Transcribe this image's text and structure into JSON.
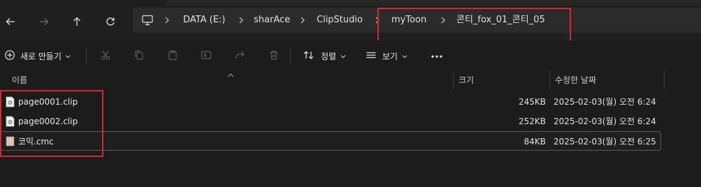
{
  "colors": {
    "accent_red": "#d8262b",
    "background": "#1c1c1c",
    "address_bg": "#2b2b2b"
  },
  "nav": {
    "back_icon": "arrow-left-icon",
    "forward_icon": "arrow-right-icon",
    "up_icon": "arrow-up-icon",
    "refresh_icon": "refresh-icon"
  },
  "address": {
    "root_icon": "this-pc-icon",
    "crumbs": [
      "DATA (E:)",
      "sharAce",
      "ClipStudio",
      "myToon",
      "콘티_fox_01_콘티_05"
    ]
  },
  "toolbar": {
    "new_label": "새로 만들기",
    "sort_label": "정렬",
    "view_label": "보기",
    "more_icon": "more-icon"
  },
  "columns": {
    "name": "이름",
    "size": "크기",
    "modified": "수정한 날짜"
  },
  "files": [
    {
      "name": "page0001.clip",
      "size": "245KB",
      "modified": "2025-02-03(월) 오전 6:24",
      "icon": "clip-file-icon"
    },
    {
      "name": "page0002.clip",
      "size": "252KB",
      "modified": "2025-02-03(월) 오전 6:24",
      "icon": "clip-file-icon"
    },
    {
      "name": "코믹.cmc",
      "size": "84KB",
      "modified": "2025-02-03(월) 오전 6:25",
      "icon": "cmc-file-icon"
    }
  ]
}
